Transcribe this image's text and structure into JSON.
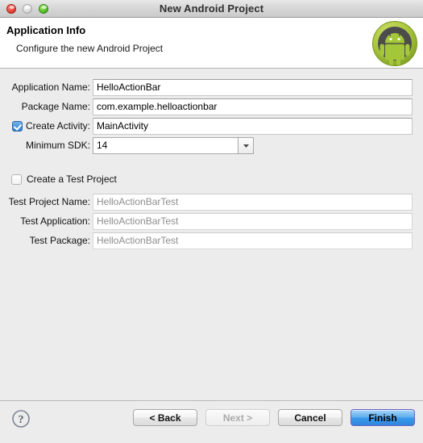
{
  "window": {
    "title": "New Android Project",
    "traffic_lights": [
      "close-button",
      "minimize-button",
      "zoom-button"
    ]
  },
  "header": {
    "title": "Application Info",
    "subtitle": "Configure the new Android Project",
    "logo_name": "android-robot-logo",
    "logo_color": "#a4c639"
  },
  "form": {
    "rows": [
      {
        "label": "Application Name:",
        "value": "HelloActionBar"
      },
      {
        "label": "Package Name:",
        "value": "com.example.helloactionbar"
      },
      {
        "label": "Create Activity:",
        "value": "MainActivity",
        "checked": true
      },
      {
        "label": "Minimum SDK:",
        "value": "14"
      }
    ],
    "test_section": {
      "checkbox_label": "Create a Test Project",
      "checked": false,
      "rows": [
        {
          "label": "Test Project Name:",
          "placeholder": "HelloActionBarTest"
        },
        {
          "label": "Test Application:",
          "placeholder": "HelloActionBarTest"
        },
        {
          "label": "Test Package:",
          "placeholder": "HelloActionBarTest"
        }
      ]
    }
  },
  "footer": {
    "help_icon": "question-mark-icon",
    "buttons": [
      {
        "label": "< Back",
        "state": "enabled"
      },
      {
        "label": "Next >",
        "state": "disabled"
      },
      {
        "label": "Cancel",
        "state": "enabled"
      },
      {
        "label": "Finish",
        "state": "default"
      }
    ],
    "accent_color": "#3b98ea"
  }
}
